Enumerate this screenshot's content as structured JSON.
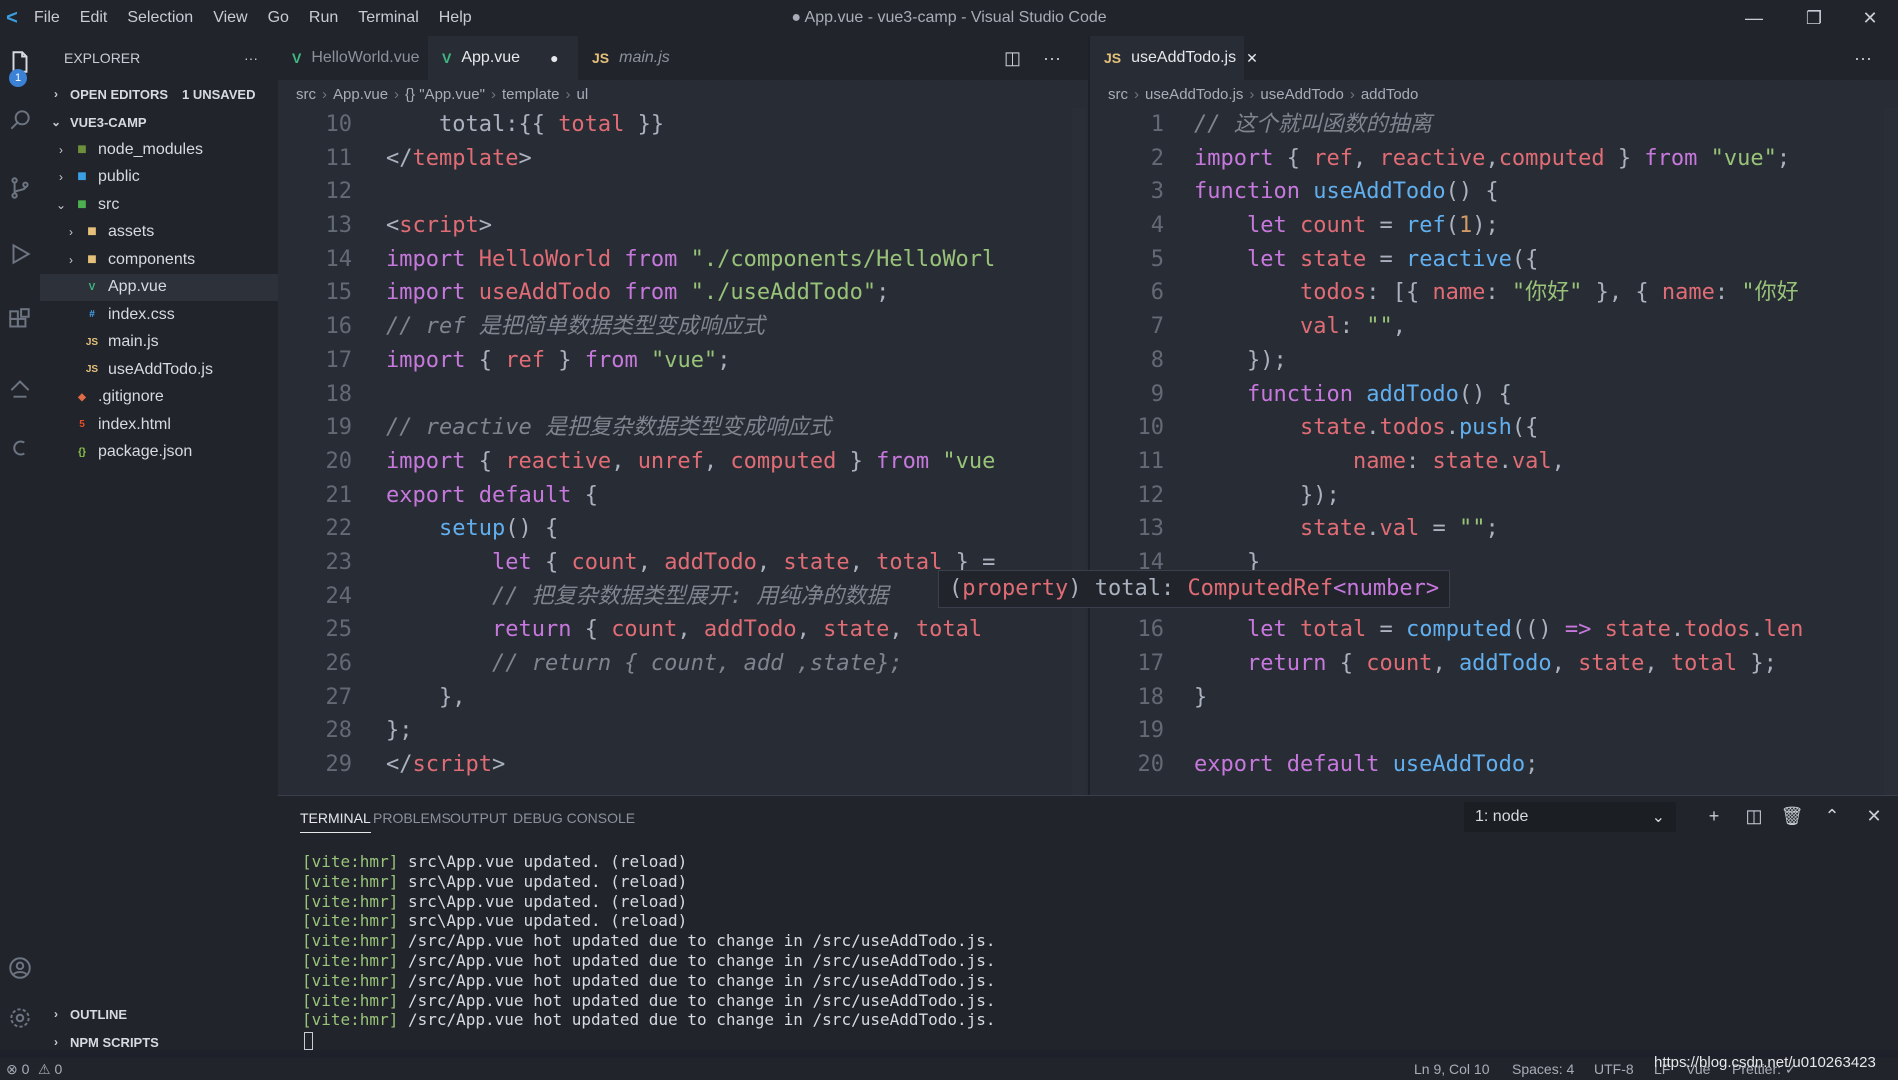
{
  "titlebar": {
    "menu": [
      "File",
      "Edit",
      "Selection",
      "View",
      "Go",
      "Run",
      "Terminal",
      "Help"
    ],
    "title": "● App.vue - vue3-camp - Visual Studio Code"
  },
  "activity": {
    "explorer_badge": "1"
  },
  "sidebar": {
    "header": "EXPLORER",
    "more": "···",
    "open_editors": "OPEN EDITORS",
    "unsaved": "1 UNSAVED",
    "project": "VUE3-CAMP",
    "tree": [
      {
        "label": "node_modules",
        "indent": 1,
        "type": "folder",
        "chev": "›"
      },
      {
        "label": "public",
        "indent": 1,
        "type": "folder-pub",
        "chev": "›"
      },
      {
        "label": "src",
        "indent": 1,
        "type": "folder-src",
        "chev": "⌄"
      },
      {
        "label": "assets",
        "indent": 2,
        "type": "folder-assets",
        "chev": "›"
      },
      {
        "label": "components",
        "indent": 2,
        "type": "folder-comp",
        "chev": "›"
      },
      {
        "label": "App.vue",
        "indent": 2,
        "type": "vue",
        "chev": ""
      },
      {
        "label": "index.css",
        "indent": 2,
        "type": "css",
        "chev": ""
      },
      {
        "label": "main.js",
        "indent": 2,
        "type": "js",
        "chev": ""
      },
      {
        "label": "useAddTodo.js",
        "indent": 2,
        "type": "js",
        "chev": ""
      },
      {
        "label": ".gitignore",
        "indent": 1,
        "type": "git",
        "chev": ""
      },
      {
        "label": "index.html",
        "indent": 1,
        "type": "html",
        "chev": ""
      },
      {
        "label": "package.json",
        "indent": 1,
        "type": "json",
        "chev": ""
      }
    ],
    "outline": "OUTLINE",
    "npm": "NPM SCRIPTS"
  },
  "left_editor": {
    "tabs": [
      {
        "label": "HelloWorld.vue",
        "icon": "V"
      },
      {
        "label": "App.vue",
        "icon": "V"
      },
      {
        "label": "main.js",
        "icon": "JS"
      }
    ],
    "breadcrumb": [
      "src",
      "App.vue",
      "{} \"App.vue\"",
      "template",
      "ul"
    ],
    "lines": [
      {
        "n": "10",
        "t": [
          [
            "pl",
            "    total:{{ "
          ],
          [
            "var",
            "total"
          ],
          [
            "pl",
            " }}"
          ]
        ]
      },
      {
        "n": "11",
        "t": [
          [
            "pl",
            "</"
          ],
          [
            "tag",
            "template"
          ],
          [
            "pl",
            ">"
          ]
        ]
      },
      {
        "n": "12",
        "t": []
      },
      {
        "n": "13",
        "t": [
          [
            "pl",
            "<"
          ],
          [
            "tag",
            "script"
          ],
          [
            "pl",
            ">"
          ]
        ]
      },
      {
        "n": "14",
        "t": [
          [
            "kw",
            "import "
          ],
          [
            "var",
            "HelloWorld "
          ],
          [
            "kw",
            "from "
          ],
          [
            "str",
            "\"./components/HelloWorl"
          ]
        ]
      },
      {
        "n": "15",
        "t": [
          [
            "kw",
            "import "
          ],
          [
            "var",
            "useAddTodo "
          ],
          [
            "kw",
            "from "
          ],
          [
            "str",
            "\"./useAddTodo\""
          ],
          [
            "pl",
            ";"
          ]
        ]
      },
      {
        "n": "16",
        "t": [
          [
            "cm",
            "// ref 是把简单数据类型变成响应式"
          ]
        ]
      },
      {
        "n": "17",
        "t": [
          [
            "kw",
            "import "
          ],
          [
            "pl",
            "{ "
          ],
          [
            "var",
            "ref"
          ],
          [
            "pl",
            " } "
          ],
          [
            "kw",
            "from "
          ],
          [
            "str",
            "\"vue\""
          ],
          [
            "pl",
            ";"
          ]
        ]
      },
      {
        "n": "18",
        "t": []
      },
      {
        "n": "19",
        "t": [
          [
            "cm",
            "// reactive 是把复杂数据类型变成响应式"
          ]
        ]
      },
      {
        "n": "20",
        "t": [
          [
            "kw",
            "import "
          ],
          [
            "pl",
            "{ "
          ],
          [
            "var",
            "reactive"
          ],
          [
            "pl",
            ", "
          ],
          [
            "var",
            "unref"
          ],
          [
            "pl",
            ", "
          ],
          [
            "var",
            "computed"
          ],
          [
            "pl",
            " } "
          ],
          [
            "kw",
            "from "
          ],
          [
            "str",
            "\"vue"
          ]
        ]
      },
      {
        "n": "21",
        "t": [
          [
            "kw",
            "export default "
          ],
          [
            "pl",
            "{"
          ]
        ]
      },
      {
        "n": "22",
        "t": [
          [
            "pl",
            "    "
          ],
          [
            "fn",
            "setup"
          ],
          [
            "pl",
            "() {"
          ]
        ]
      },
      {
        "n": "23",
        "t": [
          [
            "pl",
            "        "
          ],
          [
            "kw",
            "let "
          ],
          [
            "pl",
            "{ "
          ],
          [
            "var",
            "count"
          ],
          [
            "pl",
            ", "
          ],
          [
            "var",
            "addTodo"
          ],
          [
            "pl",
            ", "
          ],
          [
            "var",
            "state"
          ],
          [
            "pl",
            ", "
          ],
          [
            "var",
            "total"
          ],
          [
            "pl",
            " } ="
          ]
        ]
      },
      {
        "n": "24",
        "t": [
          [
            "pl",
            "        "
          ],
          [
            "cm",
            "// 把复杂数据类型展开: 用纯净的数据"
          ]
        ]
      },
      {
        "n": "25",
        "t": [
          [
            "pl",
            "        "
          ],
          [
            "kw",
            "return "
          ],
          [
            "pl",
            "{ "
          ],
          [
            "var",
            "count"
          ],
          [
            "pl",
            ", "
          ],
          [
            "var",
            "addTodo"
          ],
          [
            "pl",
            ", "
          ],
          [
            "var",
            "state"
          ],
          [
            "pl",
            ", "
          ],
          [
            "var",
            "total"
          ]
        ]
      },
      {
        "n": "26",
        "t": [
          [
            "pl",
            "        "
          ],
          [
            "cm",
            "// return { count, add ,state};"
          ]
        ]
      },
      {
        "n": "27",
        "t": [
          [
            "pl",
            "    },"
          ]
        ]
      },
      {
        "n": "28",
        "t": [
          [
            "pl",
            "};"
          ]
        ]
      },
      {
        "n": "29",
        "t": [
          [
            "pl",
            "</"
          ],
          [
            "tag",
            "script"
          ],
          [
            "pl",
            ">"
          ]
        ]
      }
    ]
  },
  "right_editor": {
    "tabs": [
      {
        "label": "useAddTodo.js",
        "icon": "JS"
      }
    ],
    "breadcrumb": [
      "src",
      "useAddTodo.js",
      "useAddTodo",
      "addTodo"
    ],
    "lines": [
      {
        "n": "1",
        "t": [
          [
            "cm",
            "// 这个就叫函数的抽离"
          ]
        ]
      },
      {
        "n": "2",
        "t": [
          [
            "kw",
            "import "
          ],
          [
            "pl",
            "{ "
          ],
          [
            "var",
            "ref"
          ],
          [
            "pl",
            ", "
          ],
          [
            "var",
            "reactive"
          ],
          [
            "pl",
            ","
          ],
          [
            "var",
            "computed"
          ],
          [
            "pl",
            " } "
          ],
          [
            "kw",
            "from "
          ],
          [
            "str",
            "\"vue\""
          ],
          [
            "pl",
            ";"
          ]
        ]
      },
      {
        "n": "3",
        "t": [
          [
            "kw",
            "function "
          ],
          [
            "fn",
            "useAddTodo"
          ],
          [
            "pl",
            "() {"
          ]
        ]
      },
      {
        "n": "4",
        "t": [
          [
            "pl",
            "    "
          ],
          [
            "kw",
            "let "
          ],
          [
            "var",
            "count"
          ],
          [
            "pl",
            " = "
          ],
          [
            "fn",
            "ref"
          ],
          [
            "pl",
            "("
          ],
          [
            "num",
            "1"
          ],
          [
            "pl",
            ");"
          ]
        ]
      },
      {
        "n": "5",
        "t": [
          [
            "pl",
            "    "
          ],
          [
            "kw",
            "let "
          ],
          [
            "var",
            "state"
          ],
          [
            "pl",
            " = "
          ],
          [
            "fn",
            "reactive"
          ],
          [
            "pl",
            "({"
          ]
        ]
      },
      {
        "n": "6",
        "t": [
          [
            "pl",
            "        "
          ],
          [
            "var",
            "todos"
          ],
          [
            "pl",
            ": [{ "
          ],
          [
            "var",
            "name"
          ],
          [
            "pl",
            ": "
          ],
          [
            "str",
            "\"你好\""
          ],
          [
            "pl",
            " }, { "
          ],
          [
            "var",
            "name"
          ],
          [
            "pl",
            ": "
          ],
          [
            "str",
            "\"你好"
          ]
        ]
      },
      {
        "n": "7",
        "t": [
          [
            "pl",
            "        "
          ],
          [
            "var",
            "val"
          ],
          [
            "pl",
            ": "
          ],
          [
            "str",
            "\"\""
          ],
          [
            "pl",
            ","
          ]
        ]
      },
      {
        "n": "8",
        "t": [
          [
            "pl",
            "    });"
          ]
        ]
      },
      {
        "n": "9",
        "t": [
          [
            "pl",
            "    "
          ],
          [
            "kw",
            "function "
          ],
          [
            "fn",
            "addTodo"
          ],
          [
            "pl",
            "() {"
          ]
        ]
      },
      {
        "n": "10",
        "t": [
          [
            "pl",
            "        "
          ],
          [
            "var",
            "state"
          ],
          [
            "pl",
            "."
          ],
          [
            "var",
            "todos"
          ],
          [
            "pl",
            "."
          ],
          [
            "fn",
            "push"
          ],
          [
            "pl",
            "({"
          ]
        ]
      },
      {
        "n": "11",
        "t": [
          [
            "pl",
            "            "
          ],
          [
            "var",
            "name"
          ],
          [
            "pl",
            ": "
          ],
          [
            "var",
            "state"
          ],
          [
            "pl",
            "."
          ],
          [
            "var",
            "val"
          ],
          [
            "pl",
            ","
          ]
        ]
      },
      {
        "n": "12",
        "t": [
          [
            "pl",
            "        });"
          ]
        ]
      },
      {
        "n": "13",
        "t": [
          [
            "pl",
            "        "
          ],
          [
            "var",
            "state"
          ],
          [
            "pl",
            "."
          ],
          [
            "var",
            "val"
          ],
          [
            "pl",
            " = "
          ],
          [
            "str",
            "\"\""
          ],
          [
            "pl",
            ";"
          ]
        ]
      },
      {
        "n": "14",
        "t": [
          [
            "pl",
            "    }"
          ]
        ]
      },
      {
        "n": "15",
        "t": []
      },
      {
        "n": "16",
        "t": [
          [
            "pl",
            "    "
          ],
          [
            "kw",
            "let "
          ],
          [
            "var",
            "total"
          ],
          [
            "pl",
            " = "
          ],
          [
            "fn",
            "computed"
          ],
          [
            "pl",
            "(() "
          ],
          [
            "kw",
            "=>"
          ],
          [
            "pl",
            " "
          ],
          [
            "var",
            "state"
          ],
          [
            "pl",
            "."
          ],
          [
            "var",
            "todos"
          ],
          [
            "pl",
            "."
          ],
          [
            "var",
            "len"
          ]
        ]
      },
      {
        "n": "17",
        "t": [
          [
            "pl",
            "    "
          ],
          [
            "kw",
            "return "
          ],
          [
            "pl",
            "{ "
          ],
          [
            "var",
            "count"
          ],
          [
            "pl",
            ", "
          ],
          [
            "fn",
            "addTodo"
          ],
          [
            "pl",
            ", "
          ],
          [
            "var",
            "state"
          ],
          [
            "pl",
            ", "
          ],
          [
            "var",
            "total"
          ],
          [
            "pl",
            " };"
          ]
        ]
      },
      {
        "n": "18",
        "t": [
          [
            "pl",
            "}"
          ]
        ]
      },
      {
        "n": "19",
        "t": []
      },
      {
        "n": "20",
        "t": [
          [
            "kw",
            "export default "
          ],
          [
            "fn",
            "useAddTodo"
          ],
          [
            "pl",
            ";"
          ]
        ]
      }
    ]
  },
  "hover": {
    "open": "(",
    "kind": "property",
    "close": ") ",
    "name": "total: ",
    "type": "ComputedRef",
    "generic": "<number>"
  },
  "panel": {
    "tabs": [
      "TERMINAL",
      "PROBLEMS",
      "OUTPUT",
      "DEBUG CONSOLE"
    ],
    "terminal_select": "1: node",
    "lines": [
      {
        "p": "[vite:hmr]",
        "m": " src\\App.vue updated. (reload)"
      },
      {
        "p": "[vite:hmr]",
        "m": " src\\App.vue updated. (reload)"
      },
      {
        "p": "[vite:hmr]",
        "m": " src\\App.vue updated. (reload)"
      },
      {
        "p": "[vite:hmr]",
        "m": " src\\App.vue updated. (reload)"
      },
      {
        "p": "[vite:hmr]",
        "m": " /src/App.vue hot updated due to change in /src/useAddTodo.js."
      },
      {
        "p": "[vite:hmr]",
        "m": " /src/App.vue hot updated due to change in /src/useAddTodo.js."
      },
      {
        "p": "[vite:hmr]",
        "m": " /src/App.vue hot updated due to change in /src/useAddTodo.js."
      },
      {
        "p": "[vite:hmr]",
        "m": " /src/App.vue hot updated due to change in /src/useAddTodo.js."
      },
      {
        "p": "[vite:hmr]",
        "m": " /src/App.vue hot updated due to change in /src/useAddTodo.js."
      }
    ]
  },
  "statusbar": {
    "errors": "⊗ 0",
    "warnings": "⚠ 0",
    "position": "Ln 9, Col 10",
    "spaces": "Spaces: 4",
    "encoding": "UTF-8",
    "eol": "LF",
    "language": "Vue",
    "formatter": "Prettier: ✓",
    "watermark": "https://blog.csdn.net/u010263423"
  },
  "colors": {
    "keyword": "#c678dd",
    "string": "#98c379",
    "variable": "#e06c75",
    "function": "#61afef",
    "comment": "#7f848e",
    "vue": "#41b883",
    "js": "#e5c07b"
  }
}
